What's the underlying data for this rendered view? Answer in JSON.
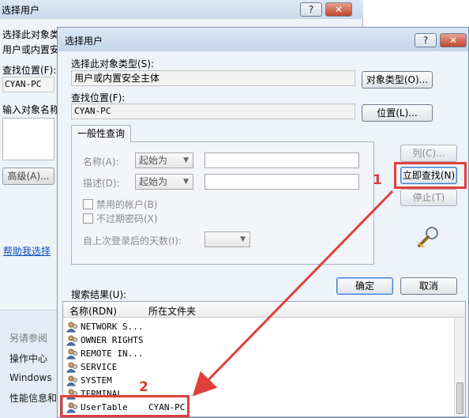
{
  "background_dialog": {
    "title": "选择用户",
    "help_glyph": "?",
    "close_glyph": "✕",
    "object_type_label": "选择此对象类",
    "object_type_value": "用户或内置安",
    "location_label": "查找位置(F):",
    "location_value": "CYAN-PC",
    "enter_names_label": "输入对象名称",
    "advanced_button": "高级(A)...",
    "help_link": "帮助我选择",
    "panel_items": [
      "另请参阅",
      "操作中心",
      "Windows",
      "性能信息和"
    ]
  },
  "dialog": {
    "title": "选择用户",
    "help_glyph": "?",
    "close_glyph": "✕",
    "object_type_label": "选择此对象类型(S):",
    "object_type_value": "用户或内置安全主体",
    "object_types_button": "对象类型(O)...",
    "location_label": "查找位置(F):",
    "location_value": "CYAN-PC",
    "locations_button": "位置(L)...",
    "query_tab": "一般性查询",
    "name_label": "名称(A):",
    "name_combo": "起始为",
    "desc_label": "描述(D):",
    "desc_combo": "起始为",
    "disabled_accounts": "禁用的帐户(B)",
    "non_expiring_pwd": "不过期密码(X)",
    "days_since_logon": "自上次登录后的天数(I):",
    "columns_button": "列(C)...",
    "find_now_button": "立即查找(N)",
    "stop_button": "停止(T)",
    "ok_button": "确定",
    "cancel_button": "取消",
    "results_label": "搜索结果(U):",
    "col_name": "名称(RDN)",
    "col_folder": "所在文件夹",
    "rows": [
      {
        "name": "NETWORK S...",
        "folder": ""
      },
      {
        "name": "OWNER RIGHTS",
        "folder": ""
      },
      {
        "name": "REMOTE IN...",
        "folder": ""
      },
      {
        "name": "SERVICE",
        "folder": ""
      },
      {
        "name": "SYSTEM",
        "folder": ""
      },
      {
        "name": "TERMINAL ...",
        "folder": ""
      },
      {
        "name": "UserTable",
        "folder": "CYAN-PC"
      }
    ]
  },
  "annotations": {
    "step1": "1",
    "step2": "2",
    "color": "#e0403a"
  }
}
